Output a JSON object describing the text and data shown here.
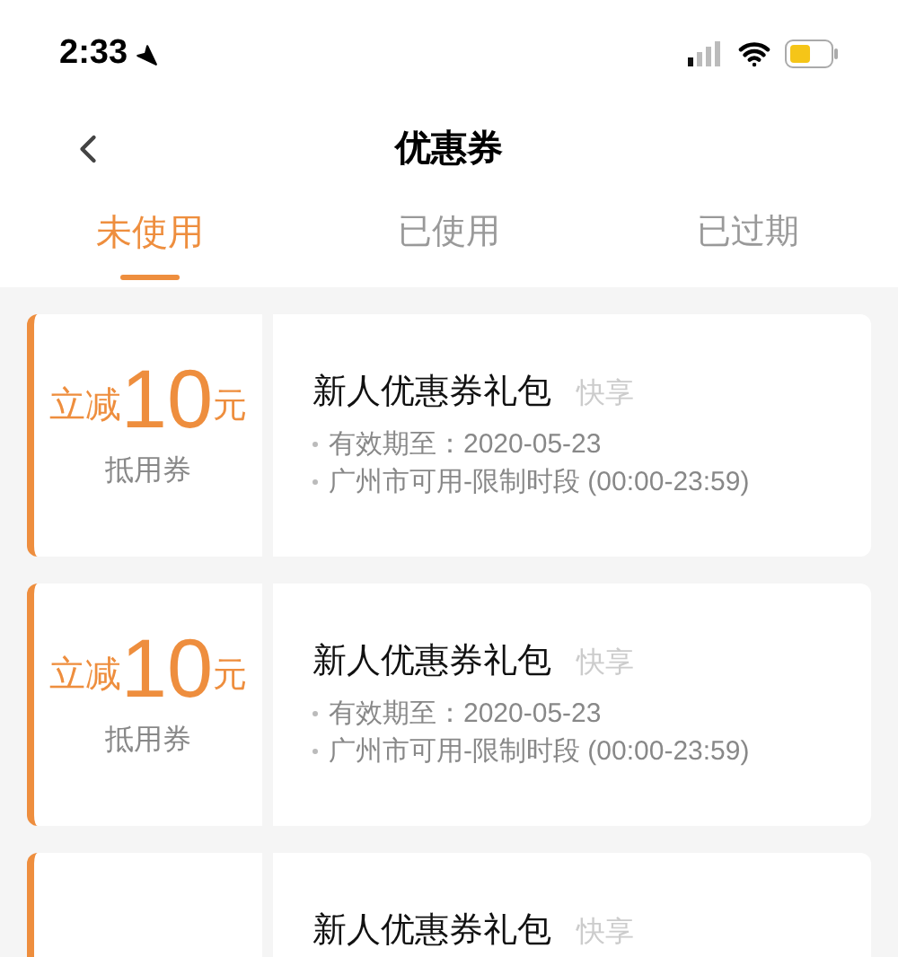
{
  "status_bar": {
    "time": "2:33"
  },
  "nav": {
    "title": "优惠券"
  },
  "tabs": [
    {
      "label": "未使用",
      "selected": true
    },
    {
      "label": "已使用",
      "selected": false
    },
    {
      "label": "已过期",
      "selected": false
    }
  ],
  "coupons": [
    {
      "prefix": "立减",
      "amount": "10",
      "unit": "元",
      "type": "抵用券",
      "title": "新人优惠券礼包",
      "tag": "快享",
      "details": [
        "有效期至：2020-05-23",
        "广州市可用-限制时段 (00:00-23:59)"
      ]
    },
    {
      "prefix": "立减",
      "amount": "10",
      "unit": "元",
      "type": "抵用券",
      "title": "新人优惠券礼包",
      "tag": "快享",
      "details": [
        "有效期至：2020-05-23",
        "广州市可用-限制时段 (00:00-23:59)"
      ]
    },
    {
      "title": "新人优惠券礼包",
      "tag": "快享"
    }
  ]
}
